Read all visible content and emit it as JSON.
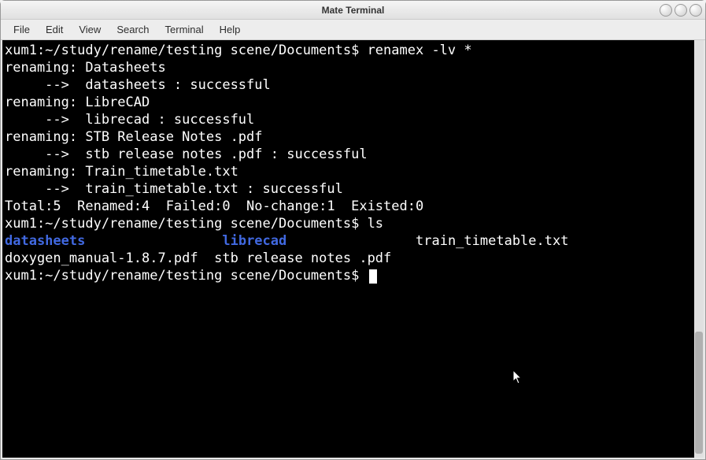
{
  "window": {
    "title": "Mate Terminal"
  },
  "menubar": {
    "items": [
      "File",
      "Edit",
      "View",
      "Search",
      "Terminal",
      "Help"
    ]
  },
  "terminal": {
    "lines": [
      {
        "segments": [
          {
            "text": "xum1:~/study/rename/testing scene/Documents$ renamex -lv *"
          }
        ]
      },
      {
        "segments": [
          {
            "text": "renaming: Datasheets"
          }
        ]
      },
      {
        "segments": [
          {
            "text": "     -->  datasheets : successful"
          }
        ]
      },
      {
        "segments": [
          {
            "text": "renaming: LibreCAD"
          }
        ]
      },
      {
        "segments": [
          {
            "text": "     -->  librecad : successful"
          }
        ]
      },
      {
        "segments": [
          {
            "text": "renaming: STB Release Notes .pdf"
          }
        ]
      },
      {
        "segments": [
          {
            "text": "     -->  stb release notes .pdf : successful"
          }
        ]
      },
      {
        "segments": [
          {
            "text": "renaming: Train_timetable.txt"
          }
        ]
      },
      {
        "segments": [
          {
            "text": "     -->  train_timetable.txt : successful"
          }
        ]
      },
      {
        "segments": [
          {
            "text": "Total:5  Renamed:4  Failed:0  No-change:1  Existed:0"
          }
        ]
      },
      {
        "segments": [
          {
            "text": "xum1:~/study/rename/testing scene/Documents$ ls"
          }
        ]
      },
      {
        "segments": [
          {
            "text": "datasheets",
            "class": "dir-color"
          },
          {
            "text": "                 "
          },
          {
            "text": "librecad",
            "class": "dir-color"
          },
          {
            "text": "                train_timetable.txt"
          }
        ]
      },
      {
        "segments": [
          {
            "text": "doxygen_manual-1.8.7.pdf  stb release notes .pdf"
          }
        ]
      },
      {
        "segments": [
          {
            "text": "xum1:~/study/rename/testing scene/Documents$ ",
            "cursor": true
          }
        ]
      }
    ]
  }
}
